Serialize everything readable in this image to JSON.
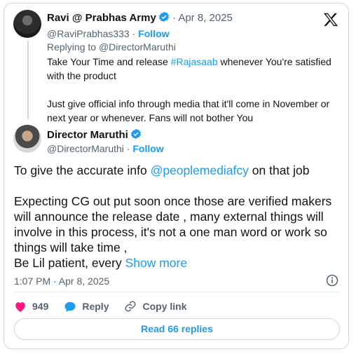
{
  "reply": {
    "author_name": "Ravi @ Prabhas Army",
    "handle": "@RaviPrabhas333",
    "separator": "·",
    "date": "Apr 8, 2025",
    "follow": "Follow",
    "replying_to_label": "Replying to",
    "replying_to_handle": "@DirectorMaruthi",
    "text_line1_pre": "Take Your Time and release ",
    "hashtag": "#Rajasaab",
    "text_line1_post": " whenever You're satisfied with the product",
    "text_para2": "Just give  official info  through media that it'll come in November or next year or whenever.   Fans will not bother You"
  },
  "post": {
    "author_name": "Director Maruthi",
    "handle": "@DirectorMaruthi",
    "separator": "·",
    "follow": "Follow",
    "para1_pre": "To give the accurate info ",
    "mention": "@peoplemediafcy",
    "para1_post": " on that job",
    "para2": "Expecting CG out put soon once those are verified makers will announce the release date , many external things will involve in this process, it's not a one man word or work so things will take time ,",
    "para3": "Be Lil patient, every ",
    "show_more": "Show more",
    "timestamp": "1:07 PM · Apr 8, 2025"
  },
  "actions": {
    "likes": "949",
    "reply": "Reply",
    "copy_link": "Copy link"
  },
  "read_replies": "Read 66 replies",
  "colors": {
    "accent": "#1d9bf0",
    "like": "#f91880",
    "text": "#0f1419",
    "muted": "#536471"
  }
}
